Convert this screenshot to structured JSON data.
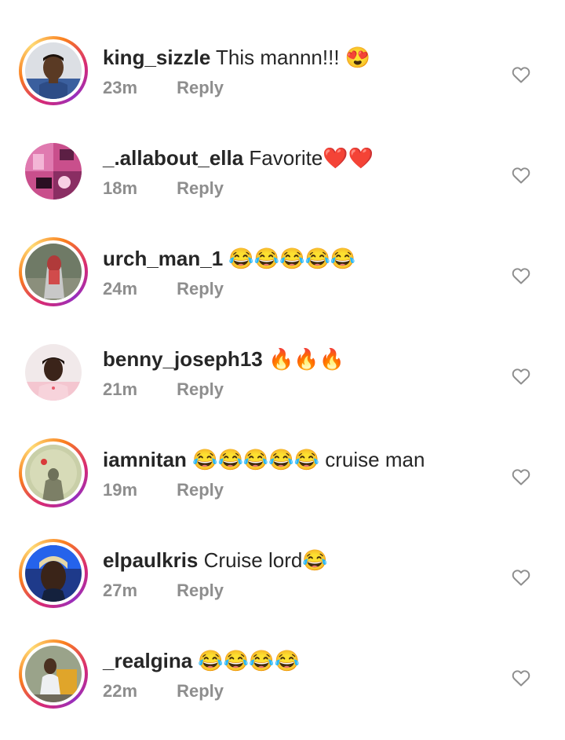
{
  "comments": [
    {
      "username": "king_sizzle",
      "text": "This mannn!!! 😍",
      "time": "23m",
      "reply": "Reply"
    },
    {
      "username": "_.allabout_ella",
      "text": "Favorite❤️❤️",
      "time": "18m",
      "reply": "Reply"
    },
    {
      "username": "urch_man_1",
      "text": "😂😂😂😂😂",
      "time": "24m",
      "reply": "Reply"
    },
    {
      "username": "benny_joseph13",
      "text": "🔥🔥🔥",
      "time": "21m",
      "reply": "Reply"
    },
    {
      "username": "iamnitan",
      "text": "😂😂😂😂😂 cruise man",
      "time": "19m",
      "reply": "Reply"
    },
    {
      "username": "elpaulkris",
      "text": "Cruise lord😂",
      "time": "27m",
      "reply": "Reply"
    },
    {
      "username": "_realgina",
      "text": "😂😂😂😂",
      "time": "22m",
      "reply": "Reply"
    }
  ],
  "icons": {
    "like": "heart-outline-icon"
  },
  "colors": {
    "text": "#262626",
    "secondary": "#8e8e8e",
    "story_ring_start": "#d62976",
    "story_ring_end": "#fa7e1e"
  }
}
